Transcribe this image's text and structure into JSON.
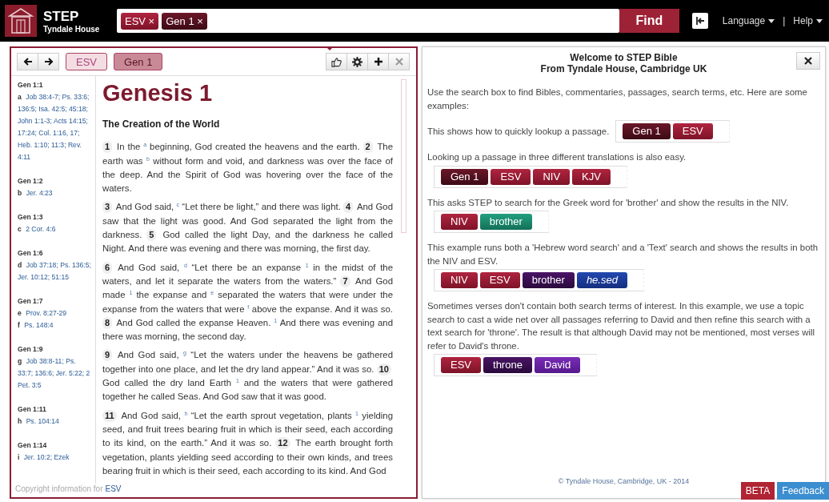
{
  "header": {
    "title": "STEP",
    "subtitle": "Tyndale House",
    "search_tags": [
      {
        "label": "ESV",
        "remove": "×",
        "kind": "version"
      },
      {
        "label": "Gen 1",
        "remove": "×",
        "kind": "passage"
      }
    ],
    "find": "Find",
    "menus": [
      {
        "label": "Language"
      },
      {
        "label": "Help"
      }
    ],
    "separator": "|"
  },
  "passage_panel": {
    "tabs": [
      {
        "label": "ESV",
        "selected": false
      },
      {
        "label": "Gen 1",
        "selected": true
      }
    ],
    "notes": [
      {
        "ref": "Gen 1:1",
        "items": [
          {
            "mark": "a",
            "refs": "Job 38:4-7; Ps. 33:6; 136:5; Isa. 42:5; 45:18; John 1:1-3; Acts 14:15; 17:24; Col. 1:16, 17; Heb. 1:10; 11:3; Rev. 4:11"
          }
        ]
      },
      {
        "ref": "Gen 1:2",
        "items": [
          {
            "mark": "b",
            "refs": "Jer. 4:23"
          }
        ]
      },
      {
        "ref": "Gen 1:3",
        "items": [
          {
            "mark": "c",
            "refs": "2 Cor. 4:6"
          }
        ]
      },
      {
        "ref": "Gen 1:6",
        "items": [
          {
            "mark": "d",
            "refs": "Job 37:18; Ps. 136:5; Jer. 10:12; 51:15"
          }
        ]
      },
      {
        "ref": "Gen 1:7",
        "items": [
          {
            "mark": "e",
            "refs": "Prov. 8:27-29"
          },
          {
            "mark": "f",
            "refs": "Ps. 148:4"
          }
        ]
      },
      {
        "ref": "Gen 1:9",
        "items": [
          {
            "mark": "g",
            "refs": "Job 38:8-11; Ps. 33:7; 136:6; Jer. 5:22; 2 Pet. 3:5"
          }
        ]
      },
      {
        "ref": "Gen 1:11",
        "items": [
          {
            "mark": "h",
            "refs": "Ps. 104:14"
          }
        ]
      },
      {
        "ref": "Gen 1:14",
        "items": [
          {
            "mark": "i",
            "refs": "Jer. 10:2; Ezek"
          }
        ]
      }
    ],
    "chapter_title": "Genesis 1",
    "section_heading": "The Creation of the World",
    "paragraphs": [
      [
        {
          "n": "1",
          "text": "In the $^{a}$ beginning, God created the heavens and the earth."
        },
        {
          "n": "2",
          "text": "The earth was $^{b}$ without form and void, and darkness was over the face of the deep. And the Spirit of God was hovering over the face of the waters."
        }
      ],
      [
        {
          "n": "3",
          "text": "And God said, $^{c}$ “Let there be light,” and there was light."
        },
        {
          "n": "4",
          "text": "And God saw that the light was good. And God separated the light from the darkness."
        },
        {
          "n": "5",
          "text": "God called the light Day, and the darkness he called Night. And there was evening and there was morning, the first day."
        }
      ],
      [
        {
          "n": "6",
          "text": "And God said, $^{d}$ “Let there be an expanse $^{1}$ in the midst of the waters, and let it separate the waters from the waters.”"
        },
        {
          "n": "7",
          "text": "And God made $^{1}$ the expanse and $^{e}$ separated the waters that were under the expanse from the waters that were $^{f}$ above the expanse. And it was so."
        },
        {
          "n": "8",
          "text": "And God called the expanse Heaven. $^{1}$ And there was evening and there was morning, the second day."
        }
      ],
      [
        {
          "n": "9",
          "text": "And God said, $^{g}$ “Let the waters under the heavens be gathered together into one place, and let the dry land appear.” And it was so."
        },
        {
          "n": "10",
          "text": "God called the dry land Earth $^{1}$ and the waters that were gathered together he called Seas. And God saw that it was good."
        }
      ],
      [
        {
          "n": "11",
          "text": "And God said, $^{h}$ “Let the earth sprout vegetation, plants $^{1}$ yielding seed, and fruit trees bearing fruit in which is their seed, each according to its kind, on the earth.” And it was so."
        },
        {
          "n": "12",
          "text": "The earth brought forth vegetation, plants yielding seed according to their own kinds, and trees bearing fruit in which is their seed, each according to its kind. And God"
        }
      ]
    ],
    "copyright": "Copyright information for",
    "copyright_link": "ESV"
  },
  "welcome_panel": {
    "title": "Welcome to STEP Bible",
    "subtitle": "From Tyndale House, Cambridge UK",
    "intro": "Use the search box to find Bibles, commentaries, passages, search terms, etc. Here are some examples:",
    "examples": [
      {
        "text": "This shows how to quickly lookup a passage.",
        "chips": [
          {
            "label": "Gen 1",
            "kind": "passage"
          },
          {
            "label": "ESV",
            "kind": "version"
          }
        ]
      },
      {
        "text": "Looking up a passage in three different translations is also easy.",
        "chips": [
          {
            "label": "Gen 1",
            "kind": "passage"
          },
          {
            "label": "ESV",
            "kind": "version"
          },
          {
            "label": "NIV",
            "kind": "version"
          },
          {
            "label": "KJV",
            "kind": "version"
          }
        ]
      },
      {
        "text": "This asks STEP to search for the Greek word for 'brother' and show the results in the NIV.",
        "chips": [
          {
            "label": "NIV",
            "kind": "version"
          },
          {
            "label": "brother",
            "kind": "greek"
          }
        ]
      },
      {
        "text": "This example runs both a 'Hebrew word search' and a 'Text' search and shows the results in both the NIV and ESV.",
        "chips": [
          {
            "label": "NIV",
            "kind": "version"
          },
          {
            "label": "ESV",
            "kind": "version"
          },
          {
            "label": "brother",
            "kind": "text"
          },
          {
            "label": "he.sed",
            "kind": "hebrew"
          }
        ]
      },
      {
        "text": "Sometimes verses don't contain both search terms of interest. In this example, we use a topic search to cast a wide net over all passages referring to David and then refine this search with a text search for 'throne'. The result is that although David may not be mentioned, most verses will refer to David's throne.",
        "chips": [
          {
            "label": "ESV",
            "kind": "version"
          },
          {
            "label": "throne",
            "kind": "text"
          },
          {
            "label": "David",
            "kind": "topic"
          }
        ]
      }
    ],
    "footer": "© Tyndale House, Cambridge, UK - 2014"
  },
  "corner_buttons": [
    {
      "label": "BETA",
      "kind": "beta"
    },
    {
      "label": "Feedback",
      "kind": "feedback"
    }
  ]
}
